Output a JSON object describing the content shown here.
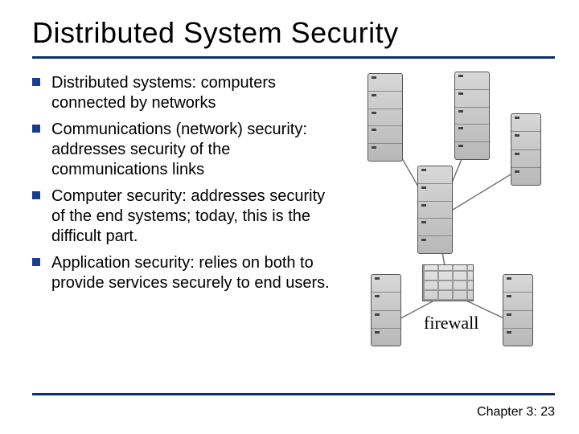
{
  "title": "Distributed System Security",
  "bullets": [
    "Distributed systems: computers connected by networks",
    "Communications (network) security: addresses security of the communications links",
    "Computer security: addresses security of the end systems; today, this is the difficult part.",
    "Application security: relies on both to provide services securely to end users."
  ],
  "figure": {
    "firewall_label": "firewall"
  },
  "footer": "Chapter 3: 23"
}
